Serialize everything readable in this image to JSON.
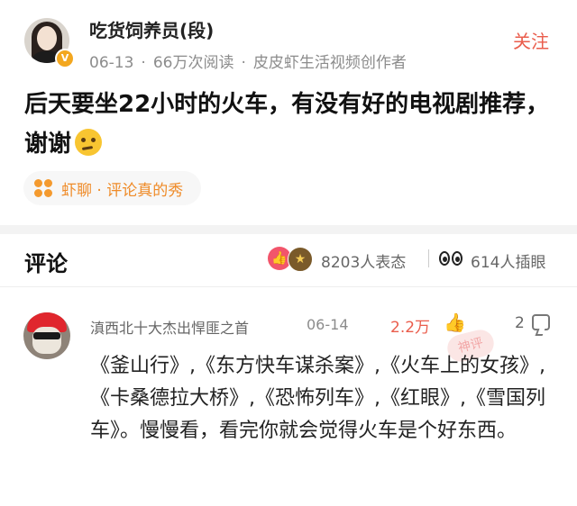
{
  "post": {
    "author_name": "吃货饲养员(段)",
    "date": "06-13",
    "views": "66万次阅读",
    "creator_tag": "皮皮虾生活视频创作者",
    "follow_label": "关注",
    "title": "后天要坐22小时的火车，有没有好的电视剧推荐，谢谢",
    "topic_tag": "虾聊 · 评论真的秀"
  },
  "comments_header": {
    "title": "评论",
    "reactions": "8203人表态",
    "collects": "614人插眼"
  },
  "comment": {
    "name": "滇西北十大杰出悍匪之首",
    "date": "06-14",
    "likes": "2.2万",
    "replies": "2",
    "watermark": "神评",
    "text": "《釜山行》,《东方快车谋杀案》,《火车上的女孩》,《卡桑德拉大桥》,《恐怖列车》,《红眼》,《雪国列车》。慢慢看，看完你就会觉得火车是个好东西。"
  },
  "colors": {
    "accent": "#ea5d4c",
    "tag_orange": "#ef8b28",
    "verified": "#f3a71f"
  },
  "icons": [
    "verified-badge-icon",
    "flower-topic-icon",
    "like-reaction-icon",
    "star-reaction-icon",
    "eyes-collect-icon",
    "thumb-up-icon",
    "reply-icon",
    "thinking-face-emoji"
  ]
}
